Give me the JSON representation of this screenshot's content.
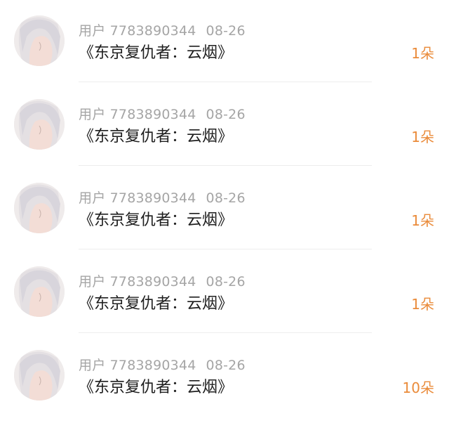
{
  "gift_list": [
    {
      "user": "用户 7783890344",
      "date": "08-26",
      "title": "《东京复仇者：云烟》",
      "count": "1朵"
    },
    {
      "user": "用户 7783890344",
      "date": "08-26",
      "title": "《东京复仇者：云烟》",
      "count": "1朵"
    },
    {
      "user": "用户 7783890344",
      "date": "08-26",
      "title": "《东京复仇者：云烟》",
      "count": "1朵"
    },
    {
      "user": "用户 7783890344",
      "date": "08-26",
      "title": "《东京复仇者：云烟》",
      "count": "1朵"
    },
    {
      "user": "用户 7783890344",
      "date": "08-26",
      "title": "《东京复仇者：云烟》",
      "count": "10朵"
    }
  ],
  "colors": {
    "count_accent": "#ea8b3a",
    "meta_text": "#a5a5a5",
    "title_text": "#1e1e1e",
    "divider": "#ededed"
  }
}
